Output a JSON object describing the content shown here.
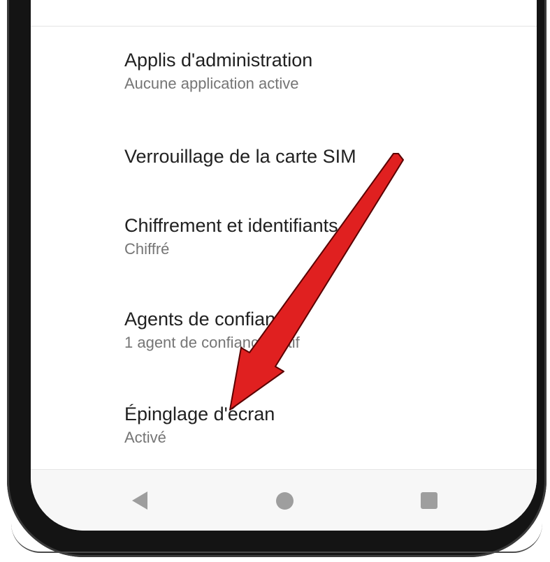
{
  "settings": {
    "items": [
      {
        "title": "Applis d'administration",
        "subtitle": "Aucune application active"
      },
      {
        "title": "Verrouillage de la carte SIM",
        "subtitle": ""
      },
      {
        "title": "Chiffrement et identifiants",
        "subtitle": "Chiffré"
      },
      {
        "title": "Agents de confiance",
        "subtitle": "1 agent de confiance actif"
      },
      {
        "title": "Épinglage d'écran",
        "subtitle": "Activé"
      }
    ]
  },
  "nav_bar": {
    "back_icon": "back-triangle-icon",
    "home_icon": "home-circle-icon",
    "recents_icon": "recents-square-icon"
  },
  "annotation": {
    "arrow_color": "#e02020"
  }
}
